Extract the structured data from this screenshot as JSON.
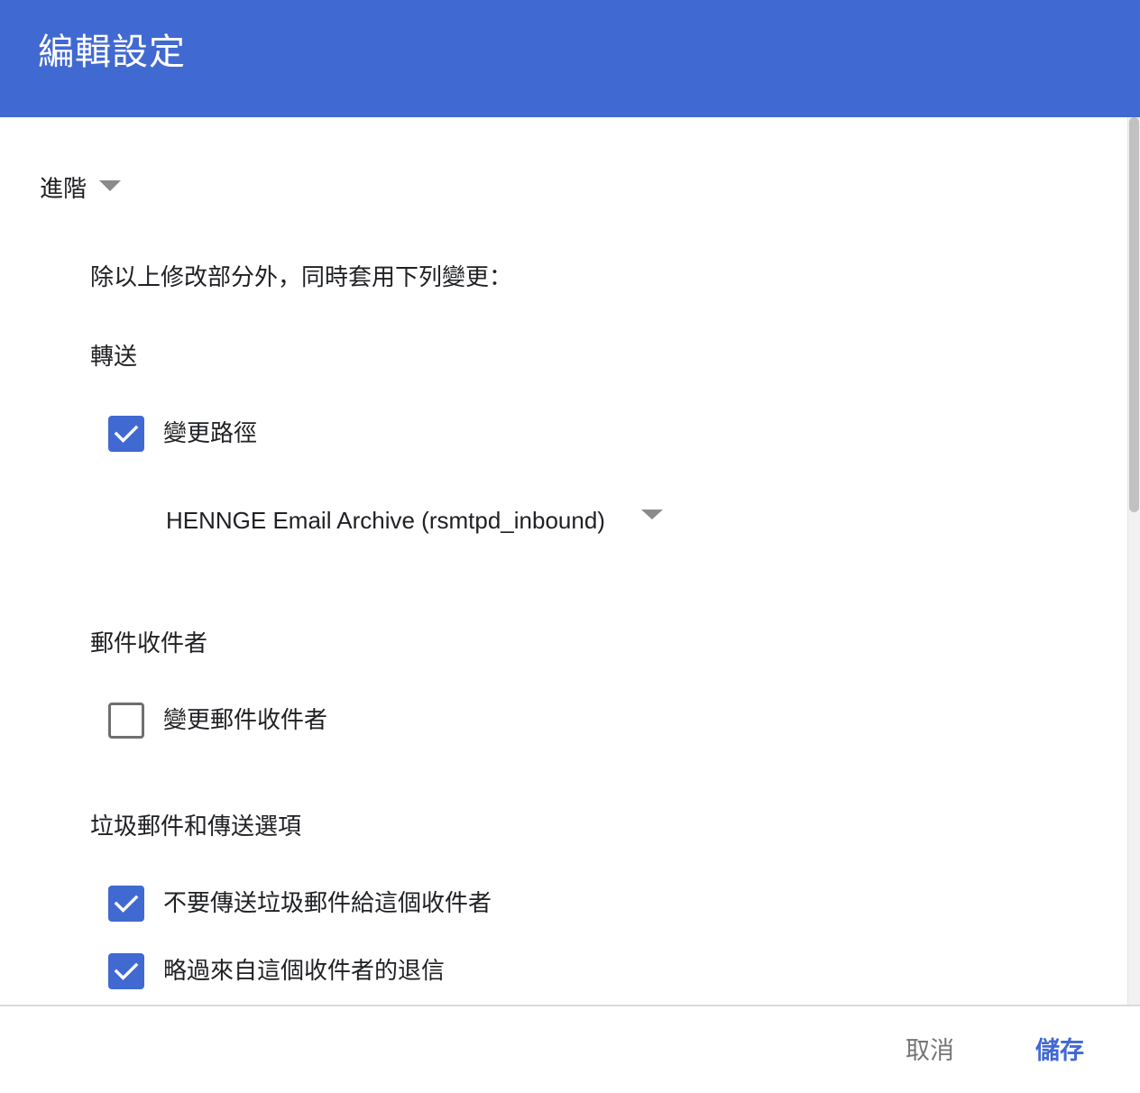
{
  "header": {
    "title": "編輯設定"
  },
  "advanced": {
    "label": "進階"
  },
  "intro_text": "除以上修改部分外，同時套用下列變更：",
  "forwarding": {
    "heading": "轉送",
    "change_route": {
      "label": "變更路徑",
      "checked": true
    },
    "route_select": {
      "value": "HENNGE Email Archive (rsmtpd_inbound)"
    }
  },
  "recipients": {
    "heading": "郵件收件者",
    "change_recipients": {
      "label": "變更郵件收件者",
      "checked": false
    }
  },
  "spam": {
    "heading": "垃圾郵件和傳送選項",
    "no_spam": {
      "label": "不要傳送垃圾郵件給這個收件者",
      "checked": true
    },
    "skip_bounces": {
      "label": "略過來自這個收件者的退信",
      "checked": true
    }
  },
  "footer": {
    "cancel_label": "取消",
    "save_label": "儲存"
  },
  "colors": {
    "accent": "#4169d2",
    "cancel_text": "#757575"
  }
}
